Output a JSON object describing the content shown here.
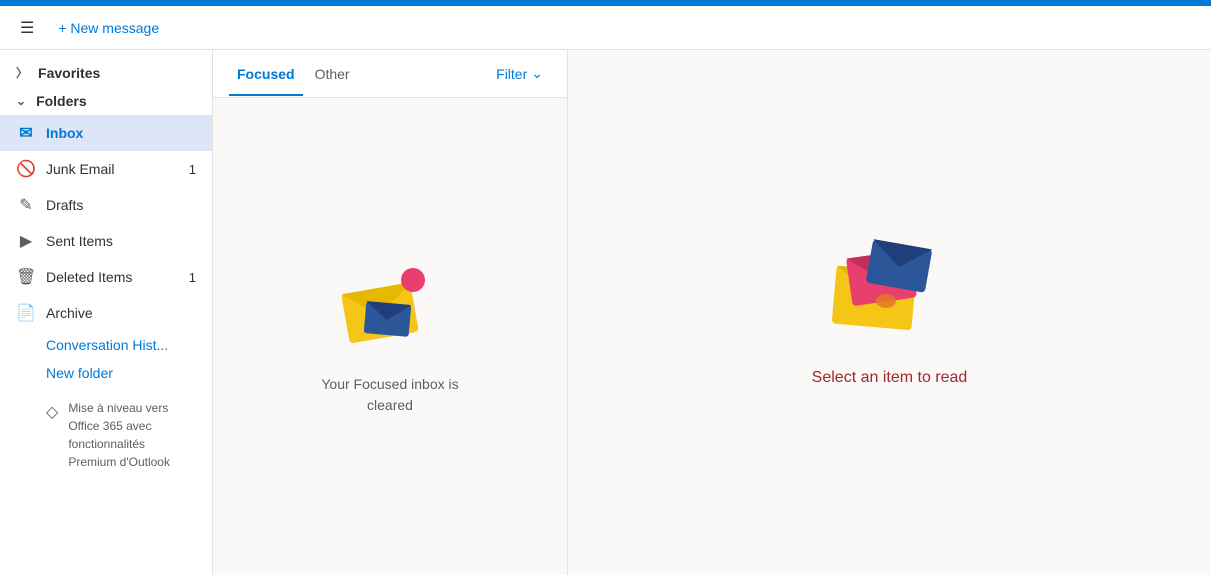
{
  "topbar": {
    "color": "#0078d4"
  },
  "toolbar": {
    "menu_label": "☰",
    "new_message_label": "+ New message"
  },
  "sidebar": {
    "favorites_label": "Favorites",
    "folders_label": "Folders",
    "inbox_label": "Inbox",
    "junk_email_label": "Junk Email",
    "junk_email_count": "1",
    "drafts_label": "Drafts",
    "sent_items_label": "Sent Items",
    "deleted_items_label": "Deleted Items",
    "deleted_items_count": "1",
    "archive_label": "Archive",
    "conversation_hist_label": "Conversation Hist...",
    "new_folder_label": "New folder",
    "upgrade_text": "Mise à niveau vers Office 365 avec fonctionnalités Premium d'Outlook"
  },
  "tabs": {
    "focused_label": "Focused",
    "other_label": "Other",
    "filter_label": "Filter"
  },
  "email_list": {
    "empty_text": "Your Focused inbox is\ncleared"
  },
  "reading_pane": {
    "empty_text": "Select an item to read"
  }
}
